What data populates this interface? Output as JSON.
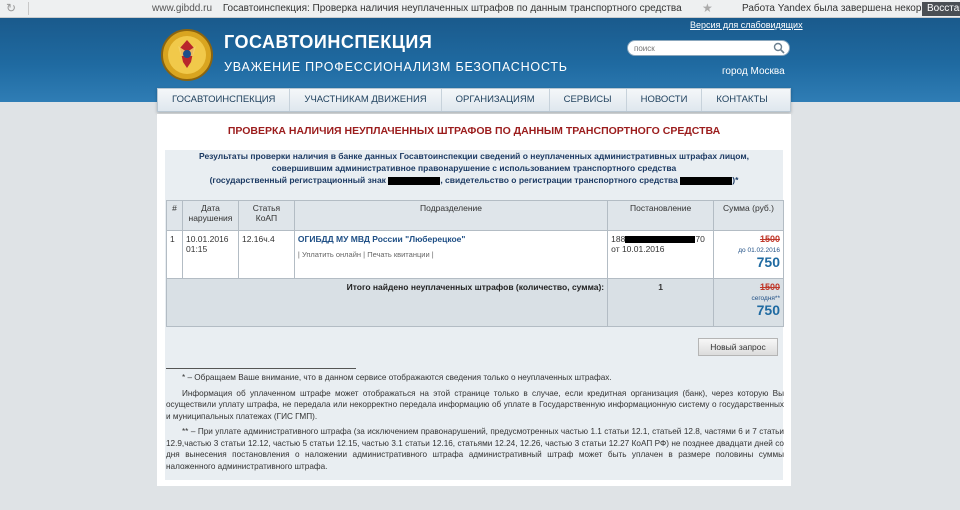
{
  "browser": {
    "host": "www.gibdd.ru",
    "page_title": "Госавтоинспекция: Проверка наличия неуплаченных штрафов по данным транспортного средства",
    "notice": "Работа Yandex была завершена некорректно.",
    "restore_button": "Восстан"
  },
  "header": {
    "title": "ГОСАВТОИНСПЕКЦИЯ",
    "slogan": "УВАЖЕНИЕ  ПРОФЕССИОНАЛИЗМ  БЕЗОПАСНОСТЬ",
    "accessible_link": "Версия для слабовидящих",
    "search_placeholder": "поиск",
    "city": "город Москва",
    "colors": {
      "header_blue": "#1f6aa1",
      "title_red": "#9b1c1c"
    }
  },
  "menu": {
    "items": [
      "ГОСАВТОИНСПЕКЦИЯ",
      "УЧАСТНИКАМ ДВИЖЕНИЯ",
      "ОРГАНИЗАЦИЯМ",
      "СЕРВИСЫ",
      "НОВОСТИ",
      "КОНТАКТЫ"
    ]
  },
  "main": {
    "page_title": "ПРОВЕРКА НАЛИЧИЯ НЕУПЛАЧЕННЫХ ШТРАФОВ ПО ДАННЫМ ТРАНСПОРТНОГО СРЕДСТВА",
    "intro_line1": "Результаты проверки наличия в банке данных Госавтоинспекции сведений о неуплаченных административных штрафах лицом,",
    "intro_line2": "совершившим административное правонарушение с использованием транспортного средства",
    "intro_line3a": "(государственный регистрационный знак",
    "intro_line3b": ", свидетельство о регистрации транспортного средства",
    "intro_line3c": ")*",
    "table": {
      "headers": [
        "#",
        "Дата нарушения",
        "Статья КоАП",
        "Подразделение",
        "Постановление",
        "Сумма (руб.)"
      ],
      "row": {
        "num": "1",
        "date": "10.01.2016",
        "time": "01:15",
        "article": "12.16ч.4",
        "department": "ОГИБДД МУ МВД России \"Люберецкое\"",
        "link_pay": "| Уплатить онлайн",
        "link_print": "| Печать квитанции |",
        "resolution_prefix": "188",
        "resolution_suffix": "70",
        "resolution_date": "от 10.01.2016",
        "old_sum": "1500",
        "until_label": "до 01.02.2016",
        "new_sum": "750"
      },
      "total": {
        "label": "Итого найдено неуплаченных штрафов (количество, сумма):",
        "count": "1",
        "old_sum": "1500",
        "today_label": "сегодня**",
        "new_sum": "750"
      }
    },
    "new_request_button": "Новый запрос",
    "notes": {
      "note1": "* – Обращаем Ваше внимание, что в данном сервисе отображаются сведения только о неуплаченных штрафах.",
      "note2": "Информация об уплаченном штрафе может отображаться на этой странице только в случае, если кредитная организация (банк), через которую Вы осуществили уплату штрафа, не передала или некорректно передала информацию об уплате в Государственную информационную систему о государственных и муниципальных платежах (ГИС ГМП).",
      "note3": "** – При уплате административного штрафа (за исключением правонарушений, предусмотренных частью 1.1 статьи 12.1, статьей 12.8, частями 6 и 7 статьи 12.9,частью 3 статьи 12.12, частью 5 статьи 12.15, частью 3.1 статьи 12.16, статьями 12.24, 12.26, частью 3 статьи 12.27 КоАП РФ) не позднее двадцати дней со дня вынесения постановления о наложении административного штрафа административный штраф может быть уплачен в размере половины суммы наложенного административного штрафа."
    }
  }
}
